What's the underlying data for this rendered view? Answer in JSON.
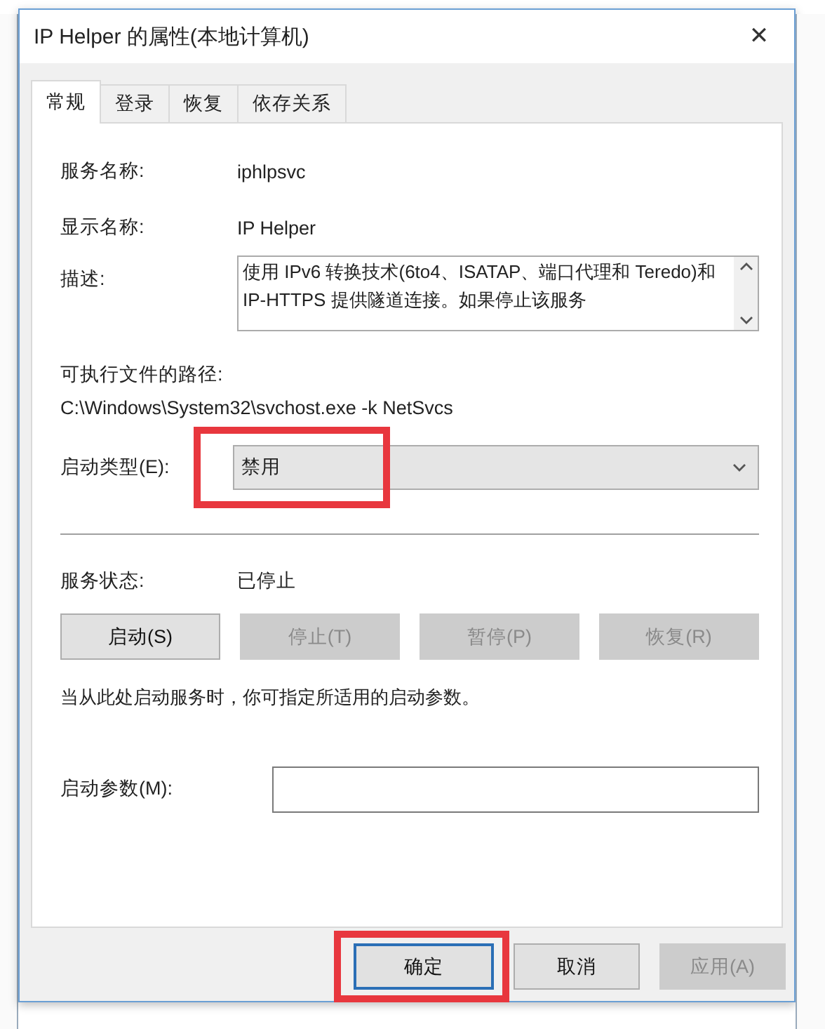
{
  "window": {
    "title": "IP Helper 的属性(本地计算机)",
    "close": "✕"
  },
  "tabs": [
    {
      "label": "常规",
      "selected": true
    },
    {
      "label": "登录",
      "selected": false
    },
    {
      "label": "恢复",
      "selected": false
    },
    {
      "label": "依存关系",
      "selected": false
    }
  ],
  "service_name": {
    "label": "服务名称:",
    "value": "iphlpsvc"
  },
  "display_name": {
    "label": "显示名称:",
    "value": "IP Helper"
  },
  "description": {
    "label": "描述:",
    "value": "使用 IPv6 转换技术(6to4、ISATAP、端口代理和 Teredo)和 IP-HTTPS 提供隧道连接。如果停止该服务"
  },
  "path": {
    "label": "可执行文件的路径:",
    "value": "C:\\Windows\\System32\\svchost.exe -k NetSvcs"
  },
  "startup_type": {
    "label": "启动类型(E):",
    "value": "禁用",
    "highlighted": true
  },
  "service_status": {
    "label": "服务状态:",
    "value": "已停止"
  },
  "service_buttons": [
    {
      "label": "启动(S)",
      "disabled": false
    },
    {
      "label": "停止(T)",
      "disabled": true
    },
    {
      "label": "暂停(P)",
      "disabled": true
    },
    {
      "label": "恢复(R)",
      "disabled": true
    }
  ],
  "hint": "当从此处启动服务时，你可指定所适用的启动参数。",
  "start_parameters": {
    "label": "启动参数(M):"
  },
  "buttons": [
    {
      "label": "确定",
      "disabled": false,
      "default": true,
      "highlighted": true
    },
    {
      "label": "取消",
      "disabled": false,
      "default": false,
      "highlighted": false
    },
    {
      "label": "应用(A)",
      "disabled": true,
      "default": false,
      "highlighted": false
    }
  ]
}
